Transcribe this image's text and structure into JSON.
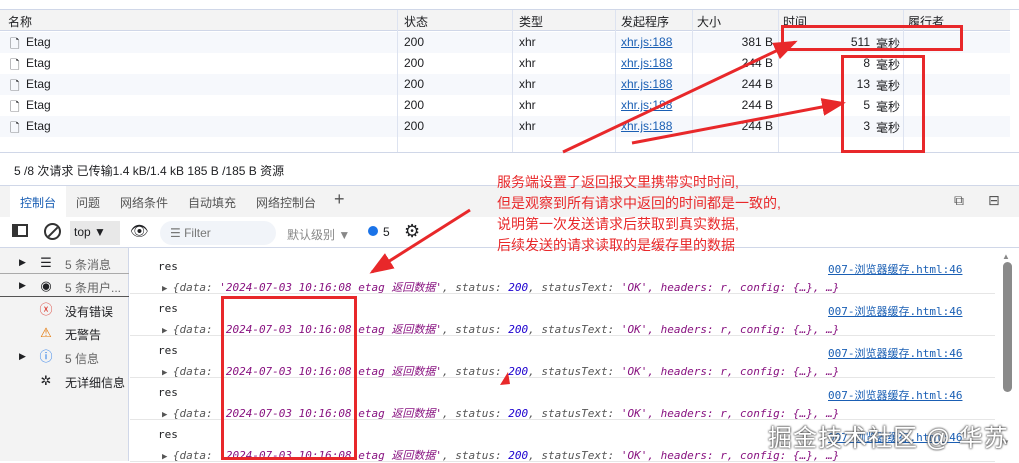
{
  "network": {
    "columns": [
      "名称",
      "状态",
      "类型",
      "发起程序",
      "大小",
      "时间",
      "履行者"
    ],
    "rows": [
      {
        "name": "Etag",
        "status": "200",
        "type": "xhr",
        "initiator": "xhr.js:188",
        "size": "381 B",
        "time": "511",
        "unit": "毫秒"
      },
      {
        "name": "Etag",
        "status": "200",
        "type": "xhr",
        "initiator": "xhr.js:188",
        "size": "244 B",
        "time": "8",
        "unit": "毫秒"
      },
      {
        "name": "Etag",
        "status": "200",
        "type": "xhr",
        "initiator": "xhr.js:188",
        "size": "244 B",
        "time": "13",
        "unit": "毫秒"
      },
      {
        "name": "Etag",
        "status": "200",
        "type": "xhr",
        "initiator": "xhr.js:188",
        "size": "244 B",
        "time": "5",
        "unit": "毫秒"
      },
      {
        "name": "Etag",
        "status": "200",
        "type": "xhr",
        "initiator": "xhr.js:188",
        "size": "244 B",
        "time": "3",
        "unit": "毫秒"
      }
    ],
    "summary": "5 /8 次请求  已传输1.4 kB/1.4 kB  185 B /185 B 资源"
  },
  "tabs": [
    "控制台",
    "问题",
    "网络条件",
    "自动填充",
    "网络控制台",
    "+"
  ],
  "toolbar": {
    "context": "top",
    "filter_placeholder": "Filter",
    "level": "默认级别",
    "badge_count": "5"
  },
  "sidebar": [
    "5 条消息",
    "5 条用户...",
    "没有错误",
    "无警告",
    "5 信息",
    "无详细信息"
  ],
  "console": {
    "label": "res",
    "prefix": "{data: ",
    "data_value": "'2024-07-03 10:16:08 etag 返回数据'",
    "mid1": ", status: ",
    "status": "200",
    "mid2": ", statusText: ",
    "status_text": "'OK'",
    "suffix": ", headers: r, config: {…}, …}",
    "source": "007-浏览器缓存.html:46",
    "count": 5
  },
  "annotation": [
    "服务端设置了返回报文里携带实时时间,",
    "但是观察到所有请求中返回的时间都是一致的,",
    "说明第一次发送请求后获取到真实数据,",
    "后续发送的请求读取的是缓存里的数据"
  ],
  "watermark": "掘金技术社区 @ 华苏",
  "colors": {
    "accent": "#1a5fb4",
    "annotation": "#e8282a"
  }
}
